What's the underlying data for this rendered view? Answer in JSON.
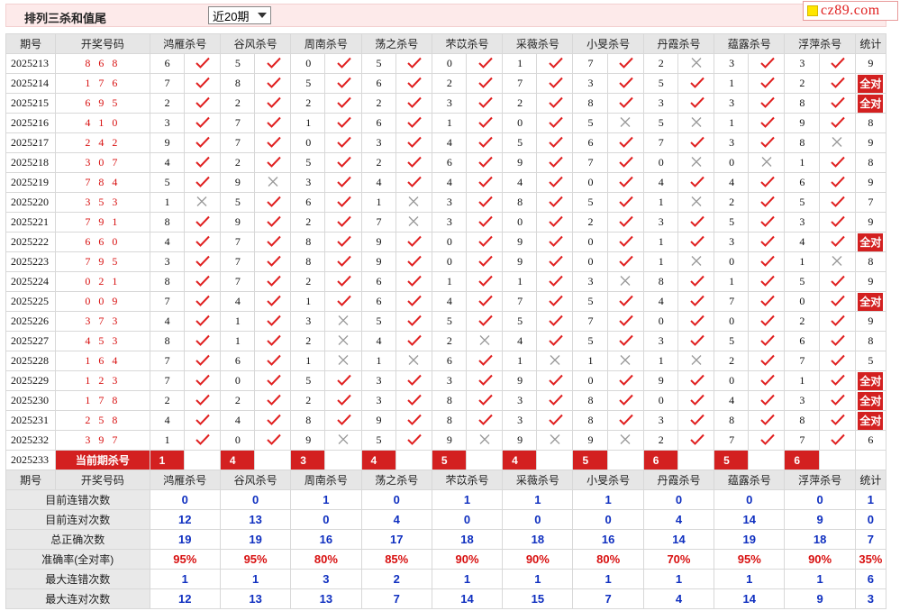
{
  "header": {
    "title": "排列三杀和值尾",
    "period_select": "近20期",
    "logo_text": "cz89.com"
  },
  "columns": {
    "issue": "期号",
    "draw": "开奖号码",
    "experts": [
      "鸿雁杀号",
      "谷风杀号",
      "周南杀号",
      "荡之杀号",
      "芣苡杀号",
      "采薇杀号",
      "小旻杀号",
      "丹霞杀号",
      "蕴露杀号",
      "浮萍杀号"
    ],
    "stat": "统计"
  },
  "rows": [
    {
      "issue": "2025213",
      "draw": "868",
      "kills": [
        [
          6,
          1
        ],
        [
          5,
          1
        ],
        [
          0,
          1
        ],
        [
          5,
          1
        ],
        [
          0,
          1
        ],
        [
          1,
          1
        ],
        [
          7,
          1
        ],
        [
          2,
          0
        ],
        [
          3,
          1
        ],
        [
          3,
          1
        ]
      ],
      "stat": "9"
    },
    {
      "issue": "2025214",
      "draw": "176",
      "kills": [
        [
          7,
          1
        ],
        [
          8,
          1
        ],
        [
          5,
          1
        ],
        [
          6,
          1
        ],
        [
          2,
          1
        ],
        [
          7,
          1
        ],
        [
          3,
          1
        ],
        [
          5,
          1
        ],
        [
          1,
          1
        ],
        [
          2,
          1
        ]
      ],
      "stat": "全对"
    },
    {
      "issue": "2025215",
      "draw": "695",
      "kills": [
        [
          2,
          1
        ],
        [
          2,
          1
        ],
        [
          2,
          1
        ],
        [
          2,
          1
        ],
        [
          3,
          1
        ],
        [
          2,
          1
        ],
        [
          8,
          1
        ],
        [
          3,
          1
        ],
        [
          3,
          1
        ],
        [
          8,
          1
        ]
      ],
      "stat": "全对"
    },
    {
      "issue": "2025216",
      "draw": "410",
      "kills": [
        [
          3,
          1
        ],
        [
          7,
          1
        ],
        [
          1,
          1
        ],
        [
          6,
          1
        ],
        [
          1,
          1
        ],
        [
          0,
          1
        ],
        [
          5,
          0
        ],
        [
          5,
          0
        ],
        [
          1,
          1
        ],
        [
          9,
          1
        ]
      ],
      "stat": "8"
    },
    {
      "issue": "2025217",
      "draw": "242",
      "kills": [
        [
          9,
          1
        ],
        [
          7,
          1
        ],
        [
          0,
          1
        ],
        [
          3,
          1
        ],
        [
          4,
          1
        ],
        [
          5,
          1
        ],
        [
          6,
          1
        ],
        [
          7,
          1
        ],
        [
          3,
          1
        ],
        [
          8,
          0
        ]
      ],
      "stat": "9"
    },
    {
      "issue": "2025218",
      "draw": "307",
      "kills": [
        [
          4,
          1
        ],
        [
          2,
          1
        ],
        [
          5,
          1
        ],
        [
          2,
          1
        ],
        [
          6,
          1
        ],
        [
          9,
          1
        ],
        [
          7,
          1
        ],
        [
          0,
          0
        ],
        [
          0,
          0
        ],
        [
          1,
          1
        ]
      ],
      "stat": "8"
    },
    {
      "issue": "2025219",
      "draw": "784",
      "kills": [
        [
          5,
          1
        ],
        [
          9,
          0
        ],
        [
          3,
          1
        ],
        [
          4,
          1
        ],
        [
          4,
          1
        ],
        [
          4,
          1
        ],
        [
          0,
          1
        ],
        [
          4,
          1
        ],
        [
          4,
          1
        ],
        [
          6,
          1
        ]
      ],
      "stat": "9"
    },
    {
      "issue": "2025220",
      "draw": "353",
      "kills": [
        [
          1,
          0
        ],
        [
          5,
          1
        ],
        [
          6,
          1
        ],
        [
          1,
          0
        ],
        [
          3,
          1
        ],
        [
          8,
          1
        ],
        [
          5,
          1
        ],
        [
          1,
          0
        ],
        [
          2,
          1
        ],
        [
          5,
          1
        ]
      ],
      "stat": "7"
    },
    {
      "issue": "2025221",
      "draw": "791",
      "kills": [
        [
          8,
          1
        ],
        [
          9,
          1
        ],
        [
          2,
          1
        ],
        [
          7,
          0
        ],
        [
          3,
          1
        ],
        [
          0,
          1
        ],
        [
          2,
          1
        ],
        [
          3,
          1
        ],
        [
          5,
          1
        ],
        [
          3,
          1
        ]
      ],
      "stat": "9"
    },
    {
      "issue": "2025222",
      "draw": "660",
      "kills": [
        [
          4,
          1
        ],
        [
          7,
          1
        ],
        [
          8,
          1
        ],
        [
          9,
          1
        ],
        [
          0,
          1
        ],
        [
          9,
          1
        ],
        [
          0,
          1
        ],
        [
          1,
          1
        ],
        [
          3,
          1
        ],
        [
          4,
          1
        ]
      ],
      "stat": "全对"
    },
    {
      "issue": "2025223",
      "draw": "795",
      "kills": [
        [
          3,
          1
        ],
        [
          7,
          1
        ],
        [
          8,
          1
        ],
        [
          9,
          1
        ],
        [
          0,
          1
        ],
        [
          9,
          1
        ],
        [
          0,
          1
        ],
        [
          1,
          0
        ],
        [
          0,
          1
        ],
        [
          1,
          0
        ]
      ],
      "stat": "8"
    },
    {
      "issue": "2025224",
      "draw": "021",
      "kills": [
        [
          8,
          1
        ],
        [
          7,
          1
        ],
        [
          2,
          1
        ],
        [
          6,
          1
        ],
        [
          1,
          1
        ],
        [
          1,
          1
        ],
        [
          3,
          0
        ],
        [
          8,
          1
        ],
        [
          1,
          1
        ],
        [
          5,
          1
        ]
      ],
      "stat": "9"
    },
    {
      "issue": "2025225",
      "draw": "009",
      "kills": [
        [
          7,
          1
        ],
        [
          4,
          1
        ],
        [
          1,
          1
        ],
        [
          6,
          1
        ],
        [
          4,
          1
        ],
        [
          7,
          1
        ],
        [
          5,
          1
        ],
        [
          4,
          1
        ],
        [
          7,
          1
        ],
        [
          0,
          1
        ]
      ],
      "stat": "全对"
    },
    {
      "issue": "2025226",
      "draw": "373",
      "kills": [
        [
          4,
          1
        ],
        [
          1,
          1
        ],
        [
          3,
          0
        ],
        [
          5,
          1
        ],
        [
          5,
          1
        ],
        [
          5,
          1
        ],
        [
          7,
          1
        ],
        [
          0,
          1
        ],
        [
          0,
          1
        ],
        [
          2,
          1
        ]
      ],
      "stat": "9"
    },
    {
      "issue": "2025227",
      "draw": "453",
      "kills": [
        [
          8,
          1
        ],
        [
          1,
          1
        ],
        [
          2,
          0
        ],
        [
          4,
          1
        ],
        [
          2,
          0
        ],
        [
          4,
          1
        ],
        [
          5,
          1
        ],
        [
          3,
          1
        ],
        [
          5,
          1
        ],
        [
          6,
          1
        ]
      ],
      "stat": "8"
    },
    {
      "issue": "2025228",
      "draw": "164",
      "kills": [
        [
          7,
          1
        ],
        [
          6,
          1
        ],
        [
          1,
          0
        ],
        [
          1,
          0
        ],
        [
          6,
          1
        ],
        [
          1,
          0
        ],
        [
          1,
          0
        ],
        [
          1,
          0
        ],
        [
          2,
          1
        ],
        [
          7,
          1
        ]
      ],
      "stat": "5"
    },
    {
      "issue": "2025229",
      "draw": "123",
      "kills": [
        [
          7,
          1
        ],
        [
          0,
          1
        ],
        [
          5,
          1
        ],
        [
          3,
          1
        ],
        [
          3,
          1
        ],
        [
          9,
          1
        ],
        [
          0,
          1
        ],
        [
          9,
          1
        ],
        [
          0,
          1
        ],
        [
          1,
          1
        ]
      ],
      "stat": "全对"
    },
    {
      "issue": "2025230",
      "draw": "178",
      "kills": [
        [
          2,
          1
        ],
        [
          2,
          1
        ],
        [
          2,
          1
        ],
        [
          3,
          1
        ],
        [
          8,
          1
        ],
        [
          3,
          1
        ],
        [
          8,
          1
        ],
        [
          0,
          1
        ],
        [
          4,
          1
        ],
        [
          3,
          1
        ]
      ],
      "stat": "全对"
    },
    {
      "issue": "2025231",
      "draw": "258",
      "kills": [
        [
          4,
          1
        ],
        [
          4,
          1
        ],
        [
          8,
          1
        ],
        [
          9,
          1
        ],
        [
          8,
          1
        ],
        [
          3,
          1
        ],
        [
          8,
          1
        ],
        [
          3,
          1
        ],
        [
          8,
          1
        ],
        [
          8,
          1
        ]
      ],
      "stat": "全对"
    },
    {
      "issue": "2025232",
      "draw": "397",
      "kills": [
        [
          1,
          1
        ],
        [
          0,
          1
        ],
        [
          9,
          0
        ],
        [
          5,
          1
        ],
        [
          9,
          0
        ],
        [
          9,
          0
        ],
        [
          9,
          0
        ],
        [
          2,
          1
        ],
        [
          7,
          1
        ],
        [
          7,
          1
        ]
      ],
      "stat": "6"
    }
  ],
  "current": {
    "issue": "2025233",
    "label": "当前期杀号",
    "kills": [
      "1",
      "4",
      "3",
      "4",
      "5",
      "4",
      "5",
      "6",
      "5",
      "6"
    ]
  },
  "summary": [
    {
      "label": "目前连错次数",
      "values": [
        "0",
        "0",
        "1",
        "0",
        "1",
        "1",
        "1",
        "0",
        "0",
        "0",
        "1"
      ]
    },
    {
      "label": "目前连对次数",
      "values": [
        "12",
        "13",
        "0",
        "4",
        "0",
        "0",
        "0",
        "4",
        "14",
        "9",
        "0"
      ]
    },
    {
      "label": "总正确次数",
      "values": [
        "19",
        "19",
        "16",
        "17",
        "18",
        "18",
        "16",
        "14",
        "19",
        "18",
        "7"
      ]
    },
    {
      "label": "准确率(全对率)",
      "values": [
        "95%",
        "95%",
        "80%",
        "85%",
        "90%",
        "90%",
        "80%",
        "70%",
        "95%",
        "90%",
        "35%"
      ]
    },
    {
      "label": "最大连错次数",
      "values": [
        "1",
        "1",
        "3",
        "2",
        "1",
        "1",
        "1",
        "1",
        "1",
        "1",
        "6"
      ]
    },
    {
      "label": "最大连对次数",
      "values": [
        "12",
        "13",
        "13",
        "7",
        "14",
        "15",
        "7",
        "4",
        "14",
        "9",
        "3"
      ]
    }
  ],
  "colors": {
    "accent": "#d32020",
    "check": "#e02020",
    "cross": "#999999",
    "stat_blue": "#1030c0"
  }
}
